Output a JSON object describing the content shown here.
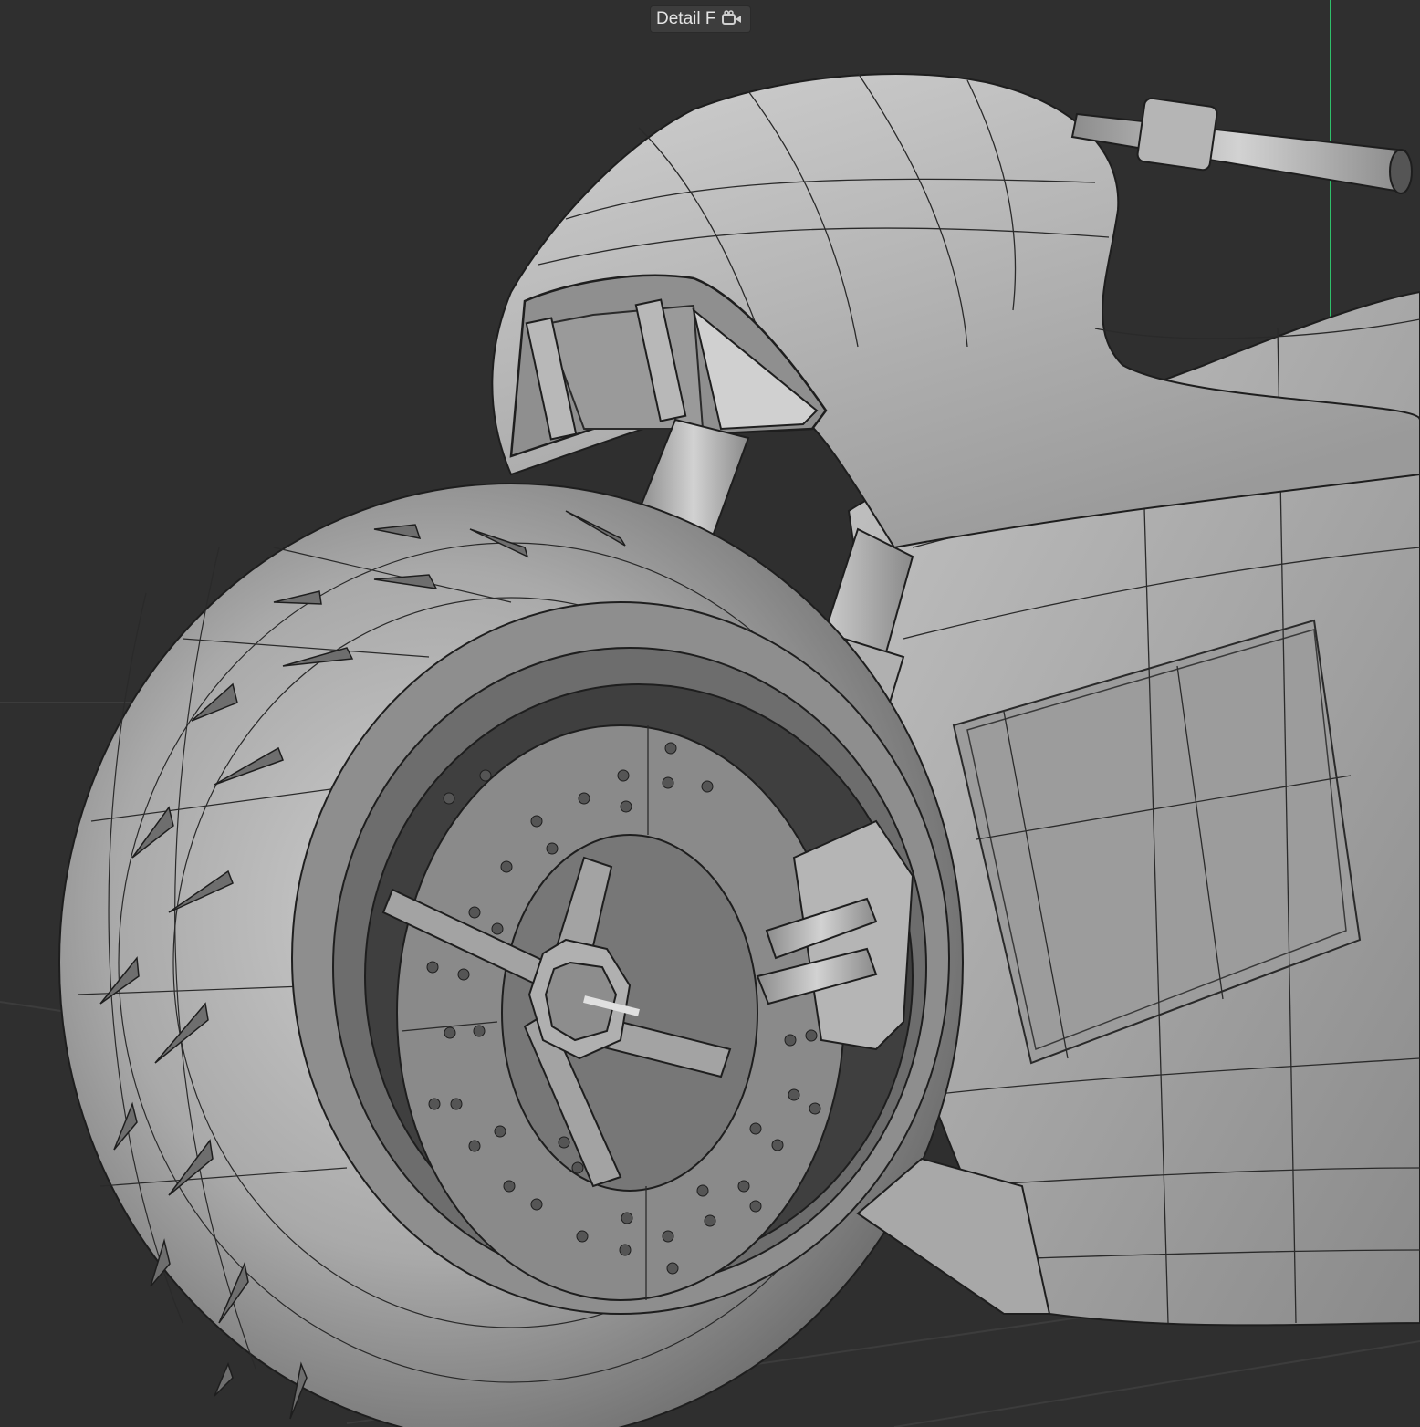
{
  "viewport": {
    "camera_name": "Detail F",
    "camera_icon": "camera-icon",
    "shading_mode": "gouraud-with-wireframe",
    "background_color": "#2f2f2f",
    "model_color": "#a6a6a6"
  },
  "scene": {
    "object": "motorcycle-front",
    "parts": [
      "front-fairing",
      "headlight",
      "handlebar",
      "fork",
      "front-tire",
      "wheel-rim",
      "brake-disc",
      "brake-caliper",
      "side-panel"
    ],
    "axes": {
      "x": "#d63a3a",
      "y": "#2fbf6a",
      "z": "#3a6ad6"
    }
  }
}
